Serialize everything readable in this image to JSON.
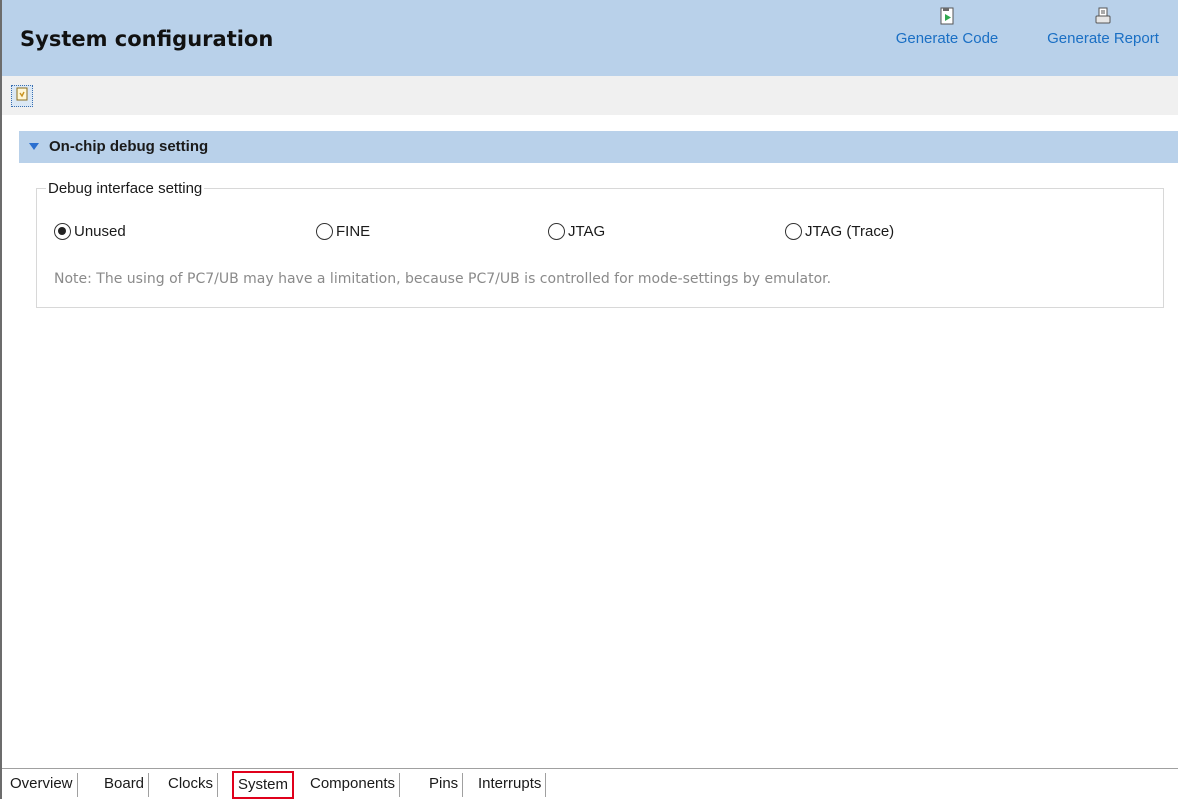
{
  "header": {
    "title": "System configuration",
    "generate_code_label": "Generate Code",
    "generate_report_label": "Generate Report"
  },
  "section": {
    "label": "On-chip debug setting"
  },
  "debug_group": {
    "legend": "Debug interface setting",
    "options": [
      {
        "label": "Unused",
        "selected": true
      },
      {
        "label": "FINE",
        "selected": false
      },
      {
        "label": "JTAG",
        "selected": false
      },
      {
        "label": "JTAG (Trace)",
        "selected": false
      }
    ],
    "note": "Note: The using of PC7/UB may have a limitation, because PC7/UB is controlled for mode-settings by emulator."
  },
  "tabs": [
    {
      "label": "Overview"
    },
    {
      "label": "Board"
    },
    {
      "label": "Clocks"
    },
    {
      "label": "System",
      "selected": true
    },
    {
      "label": "Components"
    },
    {
      "label": "Pins"
    },
    {
      "label": "Interrupts"
    }
  ],
  "colors": {
    "header_bg": "#b9d1ea",
    "link_blue": "#1a6fc4",
    "selected_tab_border": "#e0001b"
  },
  "icons": {
    "generate_code": "generate-code-icon",
    "generate_report": "generate-report-icon",
    "toolbar": "document-icon"
  }
}
